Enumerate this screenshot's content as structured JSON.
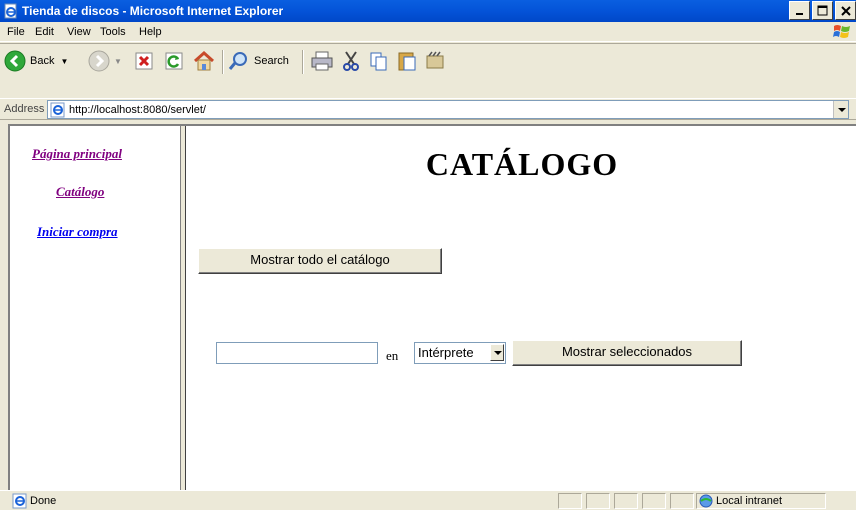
{
  "window": {
    "title": "Tienda de discos - Microsoft Internet Explorer",
    "controls": [
      "minimize",
      "maximize",
      "close"
    ]
  },
  "menubar": {
    "items": [
      {
        "label": "File"
      },
      {
        "label": "Edit"
      },
      {
        "label": "View"
      },
      {
        "label": "Tools"
      },
      {
        "label": "Help"
      }
    ]
  },
  "toolbar": {
    "back_label": "Back",
    "search_label": "Search"
  },
  "address": {
    "label": "Address",
    "url": "http://localhost:8080/servlet/"
  },
  "nav": {
    "links": [
      {
        "label": "Página principal",
        "state": "visited"
      },
      {
        "label": "Catálogo",
        "state": "visited"
      },
      {
        "label": "Iniciar compra",
        "state": "unvisited"
      }
    ]
  },
  "main": {
    "title": "CATÁLOGO",
    "show_all_button": "Mostrar todo el catálogo",
    "search": {
      "input_value": "",
      "en_label": "en",
      "field_selected": "Intérprete",
      "submit_button": "Mostrar seleccionados"
    }
  },
  "status": {
    "text": "Done",
    "zone": "Local intranet"
  },
  "colors": {
    "titlebar": "#0453d8",
    "visited_link": "#800080",
    "unvisited_link": "#0000ee",
    "chrome": "#ece9d8"
  },
  "icons": [
    "ie-page-icon",
    "windows-flag-icon",
    "back-arrow-icon",
    "forward-arrow-icon",
    "stop-icon",
    "refresh-icon",
    "home-icon",
    "search-magnifier-icon",
    "print-icon",
    "cut-icon",
    "copy-icon",
    "paste-icon",
    "media-icon",
    "local-intranet-icon"
  ]
}
